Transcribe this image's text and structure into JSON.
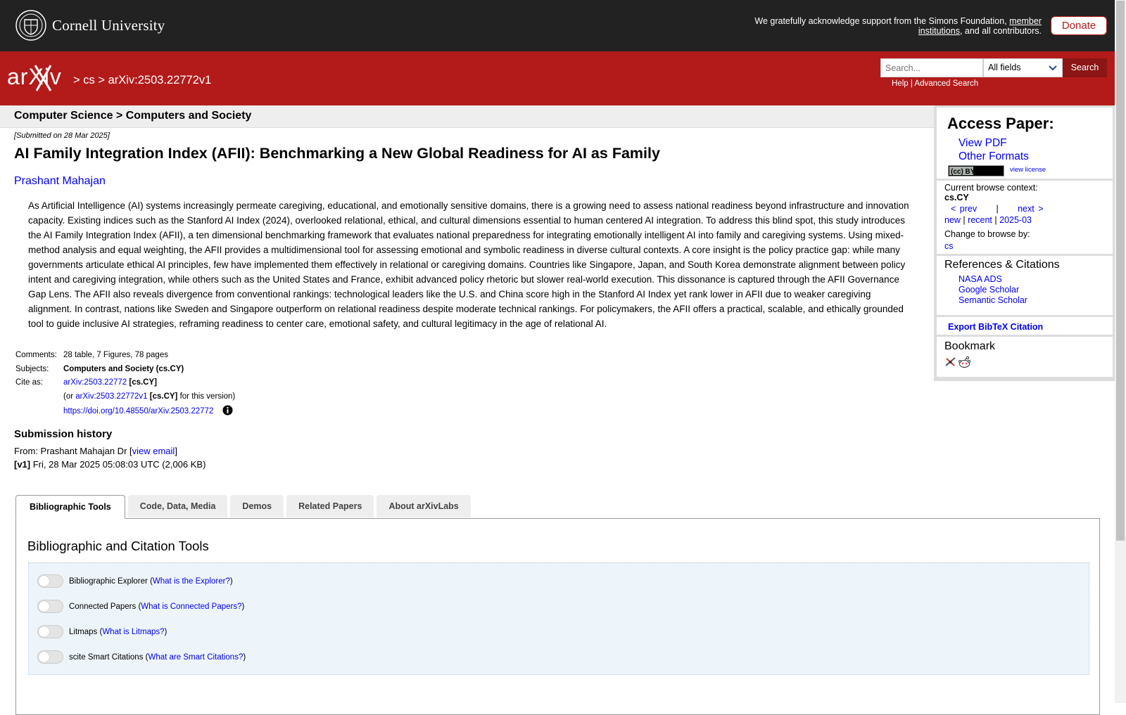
{
  "top_banner": {
    "university": "Cornell University",
    "support_text": "We gratefully acknowledge support from the Simons Foundation, ",
    "member_link": "member institutions",
    "support_suffix": ", and all contributors.",
    "donate_label": "Donate"
  },
  "header": {
    "logo_text": "arXiv",
    "breadcrumb": {
      "sep1": ">",
      "cat": "cs",
      "sep2": ">",
      "paper": "arXiv:2503.22772v1"
    },
    "search_placeholder": "Search...",
    "field_select": "All fields",
    "search_button": "Search",
    "help_link": "Help",
    "links_sep": "|",
    "advanced_link": "Advanced Search"
  },
  "subheader": "Computer Science > Computers and Society",
  "paper": {
    "submitted": "[Submitted on 28 Mar 2025]",
    "title": "AI Family Integration Index (AFII): Benchmarking a New Global Readiness for AI as Family",
    "author": "Prashant Mahajan",
    "abstract": "As Artificial Intelligence (AI) systems increasingly permeate caregiving, educational, and emotionally sensitive domains, there is a growing need to assess national readiness beyond infrastructure and innovation capacity. Existing indices such as the Stanford AI Index (2024), overlooked relational, ethical, and cultural dimensions essential to human centered AI integration. To address this blind spot, this study introduces the AI Family Integration Index (AFII), a ten dimensional benchmarking framework that evaluates national preparedness for integrating emotionally intelligent AI into family and caregiving systems. Using mixed-method analysis and equal weighting, the AFII provides a multidimensional tool for assessing emotional and symbolic readiness in diverse cultural contexts. A core insight is the policy practice gap: while many governments articulate ethical AI principles, few have implemented them effectively in relational or caregiving domains. Countries like Singapore, Japan, and South Korea demonstrate alignment between policy intent and caregiving integration, while others such as the United States and France, exhibit advanced policy rhetoric but slower real-world execution. This dissonance is captured through the AFII Governance Gap Lens. The AFII also reveals divergence from conventional rankings: technological leaders like the U.S. and China score high in the Stanford AI Index yet rank lower in AFII due to weaker caregiving alignment. In contrast, nations like Sweden and Singapore outperform on relational readiness despite moderate technical rankings. For policymakers, the AFII offers a practical, scalable, and ethically grounded tool to guide inclusive AI strategies, reframing readiness to center care, emotional safety, and cultural legitimacy in the age of relational AI."
  },
  "meta": {
    "comments_label": "Comments:",
    "comments": "28 table, 7 Figures, 78 pages",
    "subjects_label": "Subjects:",
    "subjects": "Computers and Society (cs.CY)",
    "cite_label": "Cite as:",
    "cite_id": "arXiv:2503.22772",
    "cite_cat": "[cs.CY]",
    "or_open": "(or ",
    "version_id": "arXiv:2503.22772v1",
    "version_cat": "[cs.CY]",
    "version_suffix": " for this version)",
    "doi": "https://doi.org/10.48550/arXiv.2503.22772"
  },
  "submission": {
    "heading": "Submission history",
    "from_prefix": "From: Prashant Mahajan Dr [",
    "view_email": "view email",
    "from_suffix": "]",
    "v1_label": "[v1]",
    "v1_text": " Fri, 28 Mar 2025 05:08:03 UTC (2,006 KB)"
  },
  "tabs": [
    {
      "label": "Bibliographic Tools",
      "active": true
    },
    {
      "label": "Code, Data, Media"
    },
    {
      "label": "Demos"
    },
    {
      "label": "Related Papers"
    },
    {
      "label": "About arXivLabs"
    }
  ],
  "panel": {
    "title": "Bibliographic and Citation Tools",
    "tools": [
      {
        "name": "Bibliographic Explorer",
        "link": "What is the Explorer?"
      },
      {
        "name": "Connected Papers",
        "link": "What is Connected Papers?"
      },
      {
        "name": "Litmaps",
        "link": "What is Litmaps?"
      },
      {
        "name": "scite Smart Citations",
        "link": "What are Smart Citations?"
      }
    ]
  },
  "sidebar": {
    "access_heading": "Access Paper:",
    "view_pdf": "View PDF",
    "other_formats": "Other Formats",
    "license_badge": "(cc) BY",
    "view_license": "view license",
    "browse_context_label": "Current browse context:",
    "browse_context": "cs.CY",
    "prev": "< prev",
    "nav_sep": "|",
    "next": "next >",
    "new": "new",
    "recent": "recent",
    "month": "2025-03",
    "change_browse_label": "Change to browse by:",
    "change_browse_cat": "cs",
    "refs_heading": "References & Citations",
    "refs": [
      "NASA ADS",
      "Google Scholar",
      "Semantic Scholar"
    ],
    "bibtex": "Export BibTeX Citation",
    "bookmark_heading": "Bookmark"
  },
  "colors": {
    "arxiv_red": "#b31b1b",
    "banner_dark": "#222222",
    "link_blue": "#0000ee"
  }
}
